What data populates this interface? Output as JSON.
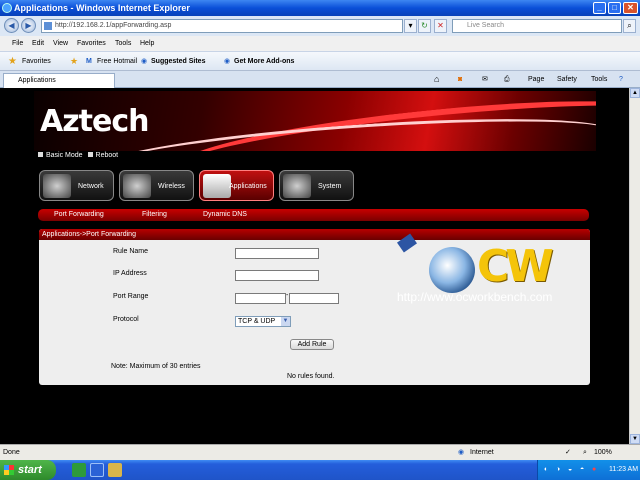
{
  "window": {
    "title": "Applications - Windows Internet Explorer"
  },
  "addressbar": {
    "url": "http://192.168.2.1/appForwarding.asp",
    "search_placeholder": "Live Search"
  },
  "menubar": [
    "File",
    "Edit",
    "View",
    "Favorites",
    "Tools",
    "Help"
  ],
  "favbar": {
    "favorites": "Favorites",
    "hotmail": "Free Hotmail",
    "suggested": "Suggested Sites",
    "addons": "Get More Add-ons"
  },
  "tab": {
    "label": "Applications"
  },
  "toolbar": {
    "page": "Page",
    "safety": "Safety",
    "tools": "Tools"
  },
  "router": {
    "brand": "Aztech",
    "topnav": {
      "basic_mode": "Basic Mode",
      "reboot": "Reboot"
    },
    "tabs": [
      "Network",
      "Wireless",
      "Applications",
      "System"
    ],
    "subnav": [
      "Port Forwarding",
      "Filtering",
      "Dynamic DNS"
    ],
    "panel_title": "Applications->Port Forwarding",
    "form": {
      "rule_name_label": "Rule Name",
      "ip_label": "IP Address",
      "port_range_label": "Port Range",
      "protocol_label": "Protocol",
      "protocol_value": "TCP & UDP",
      "add_rule": "Add Rule",
      "note": "Note: Maximum of 30 entries",
      "no_rules": "No rules found."
    }
  },
  "watermark": {
    "url": "http://www.ocworkbench.com"
  },
  "statusbar": {
    "left": "Done",
    "zone": "Internet",
    "zoom": "100%"
  },
  "taskbar": {
    "start": "start",
    "clock": "11:23 AM"
  }
}
